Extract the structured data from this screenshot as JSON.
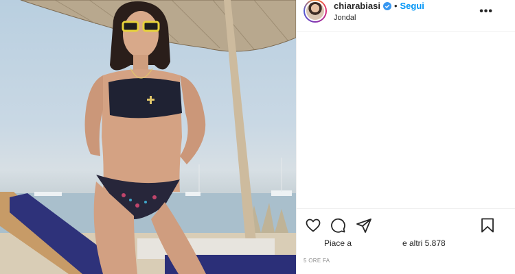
{
  "header": {
    "username": "chiarabiasi",
    "separator": "•",
    "follow_label": "Segui",
    "location": "Jondal",
    "more_label": "•••"
  },
  "likes": {
    "prefix": "Piace a",
    "suffix": "e altri 5.878"
  },
  "timestamp": "5 ORE FA",
  "icons": {
    "verified": "verified-badge-icon",
    "like": "heart-icon",
    "comment": "comment-icon",
    "share": "send-icon",
    "save": "bookmark-icon",
    "more": "more-options-icon"
  },
  "colors": {
    "follow": "#0095f6",
    "verified": "#3897f0",
    "text": "#262626",
    "muted": "#8e8e8e"
  }
}
